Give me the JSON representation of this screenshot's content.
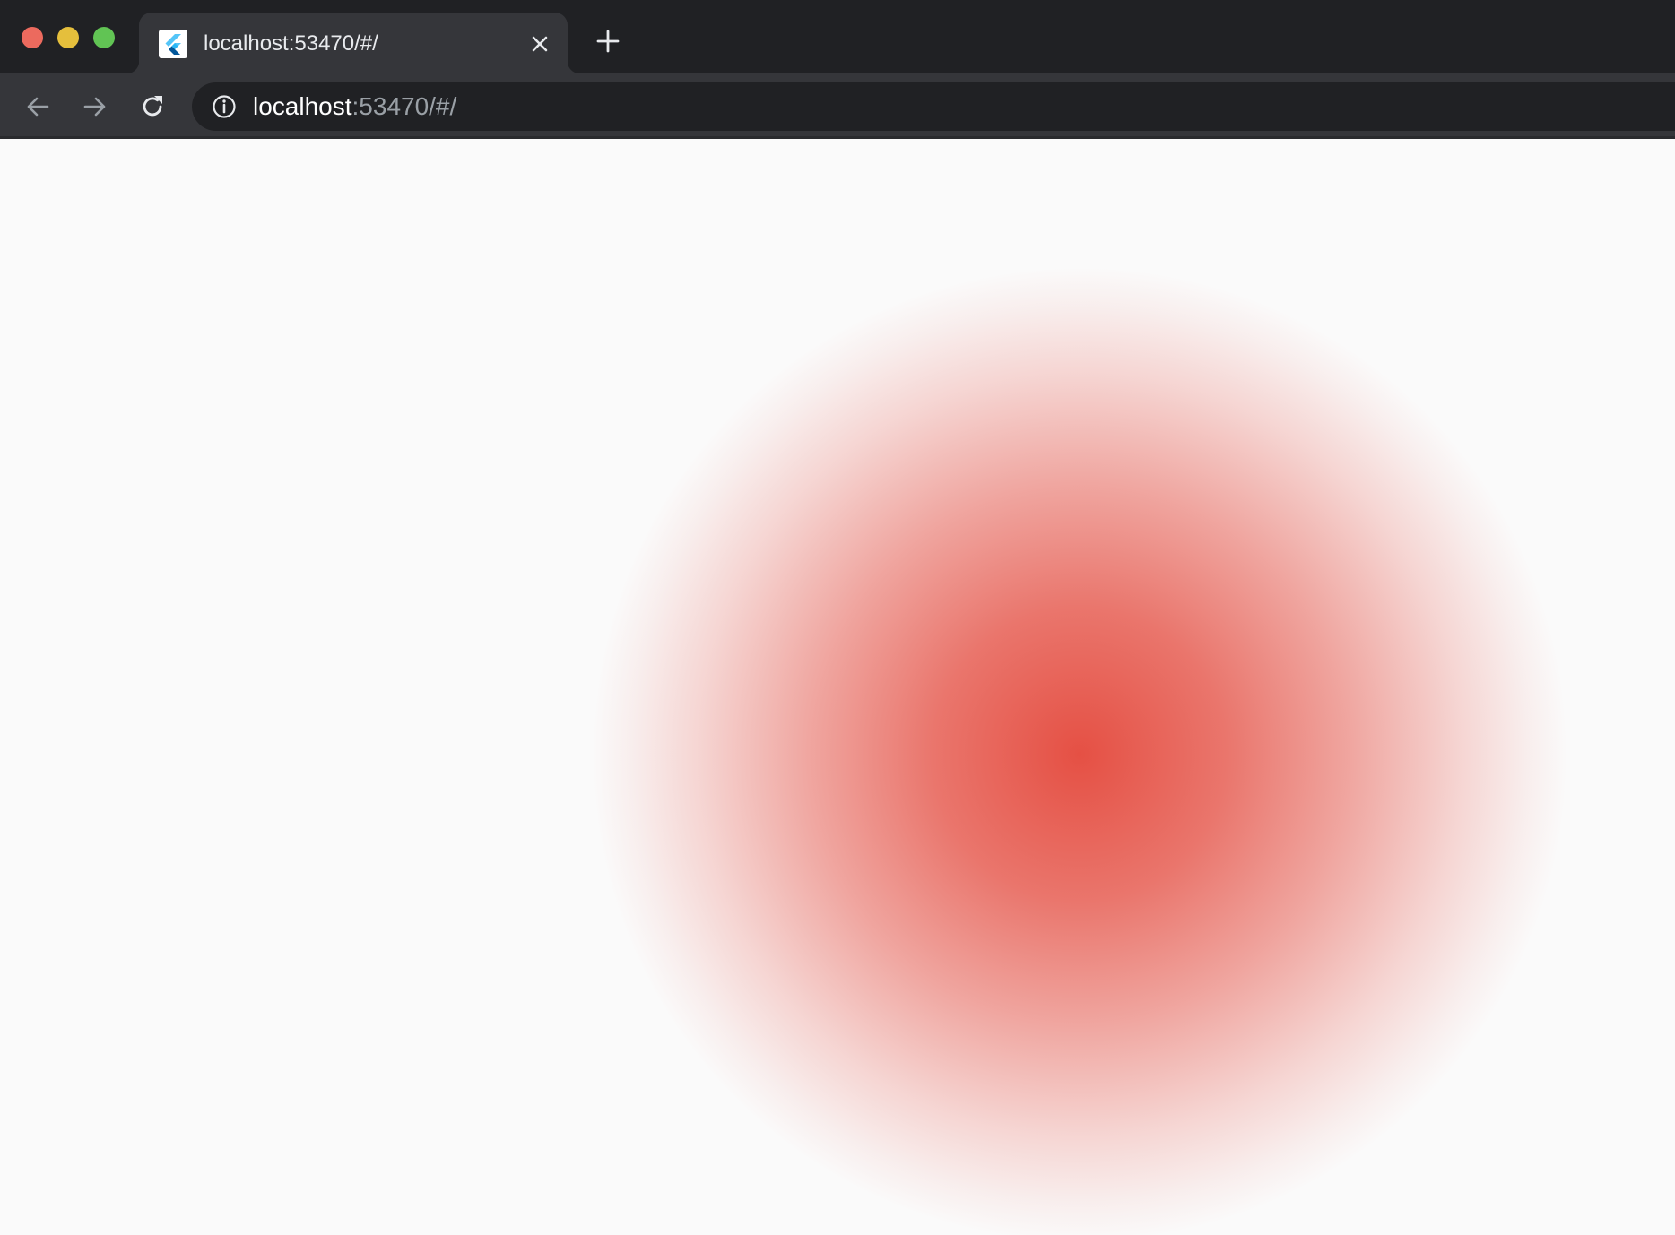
{
  "browser": {
    "tab": {
      "title": "localhost:53470/#/",
      "favicon": "flutter-logo-icon"
    },
    "address_bar": {
      "host": "localhost",
      "rest": ":53470/#/"
    },
    "icons": {
      "back": "arrow-left-icon",
      "forward": "arrow-right-icon",
      "reload": "reload-icon",
      "info": "info-icon",
      "close_tab": "close-icon",
      "new_tab": "plus-icon"
    },
    "traffic_lights": {
      "close": "#ec6a5e",
      "minimize": "#e5bf3c",
      "maximize": "#61c454"
    }
  },
  "page": {
    "background_color": "#fafafa",
    "gradient": {
      "shape": "radial",
      "center_color": "#e55044",
      "edge_color": "transparent"
    }
  }
}
